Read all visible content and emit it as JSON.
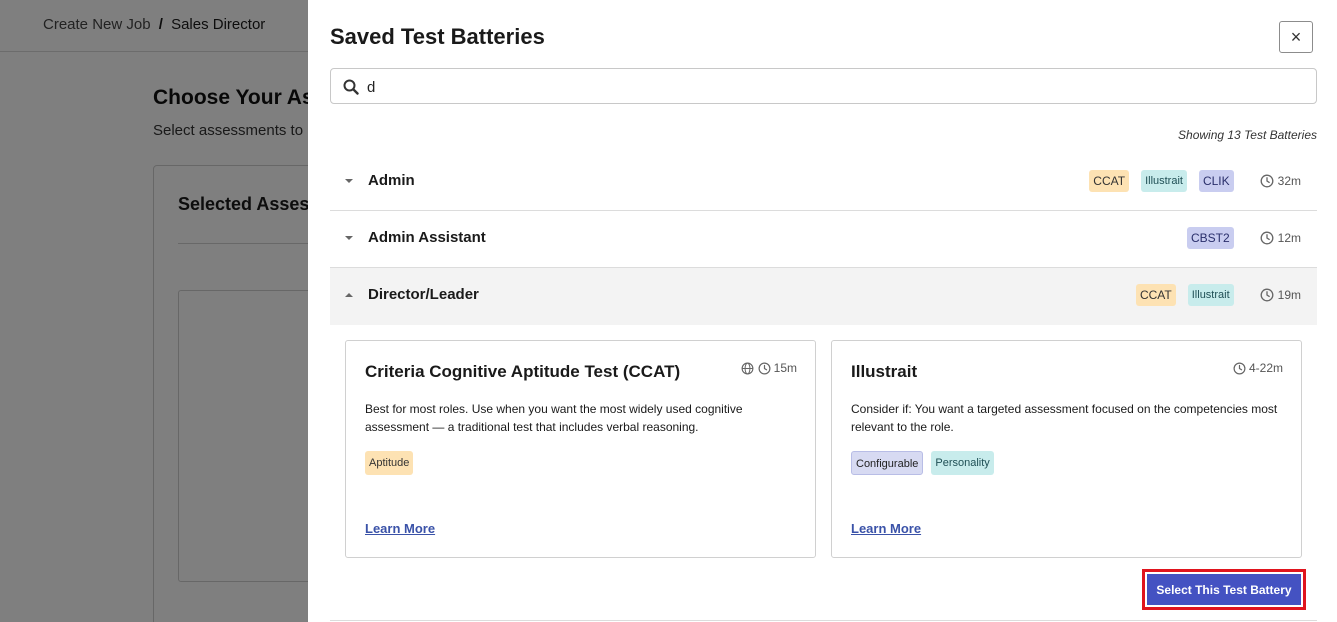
{
  "background": {
    "breadcrumb": {
      "root": "Create New Job",
      "separator": "/",
      "current": "Sales Director"
    },
    "title": "Choose Your As",
    "subtitle": "Select assessments to",
    "card_title": "Selected Assess"
  },
  "drawer": {
    "title": "Saved Test Batteries",
    "close_label": "×",
    "search": {
      "value": "d",
      "placeholder": ""
    },
    "showing_text": "Showing 13 Test Batteries",
    "rows": [
      {
        "name": "Admin",
        "expanded": false,
        "tags": [
          {
            "label": "CCAT",
            "bg": "#fde2b3",
            "fg": "#333333"
          },
          {
            "label": "Illustrait",
            "bg": "#c8ecec",
            "fg": "#1f4f55"
          },
          {
            "label": "CLIK",
            "bg": "#c9cdf0",
            "fg": "#2a2f6b"
          }
        ],
        "time": "32m"
      },
      {
        "name": "Admin Assistant",
        "expanded": false,
        "tags": [
          {
            "label": "CBST2",
            "bg": "#c9cdf0",
            "fg": "#2a2f6b"
          }
        ],
        "time": "12m"
      },
      {
        "name": "Director/Leader",
        "expanded": true,
        "tags": [
          {
            "label": "CCAT",
            "bg": "#fde2b3",
            "fg": "#333333"
          },
          {
            "label": "Illustrait",
            "bg": "#c8ecec",
            "fg": "#1f4f55"
          }
        ],
        "time": "19m"
      }
    ],
    "assessments": [
      {
        "title": "Criteria Cognitive Aptitude Test (CCAT)",
        "has_globe": true,
        "time": "15m",
        "description": "Best for most roles. Use when you want the most widely used cognitive assessment — a traditional test that includes verbal reasoning.",
        "tags": [
          {
            "label": "Aptitude",
            "bg": "#fde2b3",
            "fg": "#333333"
          }
        ],
        "learn_more": "Learn More"
      },
      {
        "title": "Illustrait",
        "has_globe": false,
        "time": "4-22m",
        "description": "Consider if: You want a targeted assessment focused on the competencies most relevant to the role.",
        "tags": [
          {
            "label": "Configurable",
            "bg": "#d7daf2",
            "fg": "#222222"
          },
          {
            "label": "Personality",
            "bg": "#c8ecec",
            "fg": "#1f4f55"
          }
        ],
        "learn_more": "Learn More"
      }
    ],
    "select_button": "Select This Test Battery"
  },
  "icons": {
    "search": "search-icon",
    "close": "close-icon",
    "chevron_down": "chevron-down-icon",
    "chevron_up": "chevron-up-icon",
    "clock": "clock-icon",
    "globe": "globe-icon"
  },
  "colors": {
    "accent": "#4452c2",
    "highlight": "#e0141e",
    "link": "#3a52a8"
  }
}
